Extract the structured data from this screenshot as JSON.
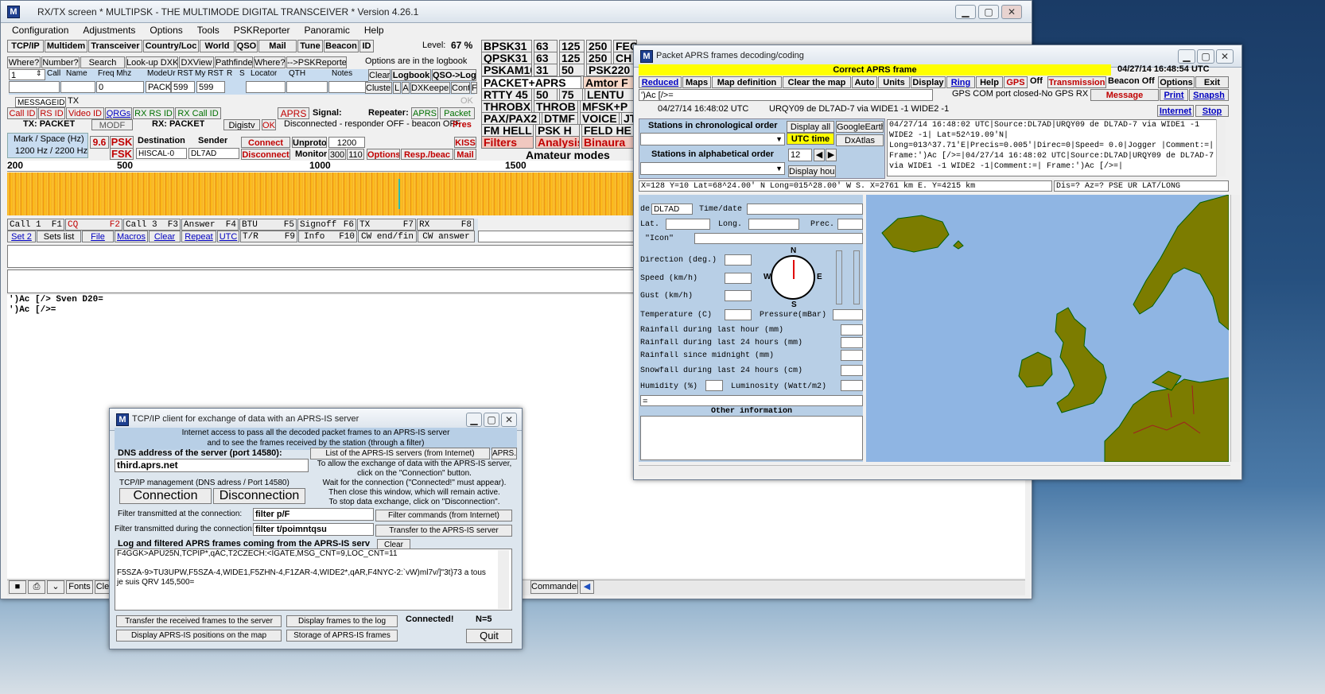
{
  "main": {
    "title": "RX/TX screen  * MULTIPSK - THE MULTIMODE DIGITAL TRANSCEIVER *   Version 4.26.1",
    "menu": [
      "Configuration",
      "Adjustments",
      "Options",
      "Tools",
      "PSKReporter",
      "Panoramic",
      "Help"
    ],
    "toolbar": [
      "TCP/IP",
      "Multidem",
      "Transceiver",
      "Country/Loc",
      "World",
      "QSO",
      "Mail",
      "Tune",
      "Beacon",
      "ID"
    ],
    "level_label": "Level:",
    "level_value": "67 %",
    "lookup": [
      "Where?",
      "Number?",
      "Search",
      "Look-up DXK",
      "DXView",
      "Pathfinder",
      "Where?",
      "-->PSKReporter"
    ],
    "logbook_note": "Options are in the logbook",
    "log_headers": [
      "Call",
      "Name",
      "Freq Mhz",
      "ModeUr",
      "RST",
      "My RST",
      "R",
      "S",
      "Locator",
      "QTH",
      "Notes"
    ],
    "log_row_num": "1",
    "log_freq": "0",
    "log_mode": "PACK",
    "log_rst": "599",
    "log_myrst": "599",
    "log_buttons": [
      "Clear",
      "Logbook",
      "QSO->Log",
      "Cluster",
      "L",
      "A",
      "DXKeeper",
      "Cont",
      "F"
    ],
    "messageid": "MESSAGEID",
    "tx_label": "TX",
    "ok": "OK",
    "id_buttons": [
      "Call ID",
      "RS ID",
      "Video ID",
      "QRGs",
      "RX RS ID",
      "RX Call ID",
      "APRS"
    ],
    "signal_label": "Signal:",
    "repeater_label": "Repeater:",
    "aprs_btn": "APRS",
    "packet_btn": "Packet",
    "tx_mode": "TX: PACKET",
    "modf": "MODF",
    "rx_mode": "RX: PACKET",
    "digistv": "Digistv",
    "ok2": "OK",
    "disconnected_status": "Disconnected - responder OFF - beacon OFF",
    "pres": "Pres",
    "mark_space_label": "Mark / Space (Hz)",
    "mark_space_value": "1200 Hz / 2200 Hz",
    "baud": "9.6",
    "psk": "PSK",
    "fsk": "FSK",
    "dest_label": "Destination",
    "sender_label": "Sender",
    "dest_value": "HISCAL-0",
    "sender_value": "DL7AD",
    "connect": "Connect",
    "disconnect": "Disconnect",
    "unproto": "Unproto",
    "monitor": "Monitor",
    "speed_1200": "1200",
    "speed_300": "300",
    "speed_110": "110",
    "options_btn": "Options",
    "resp_btn": "Resp./beac",
    "kiss": "KISS",
    "mail_btn": "Mail",
    "modes": [
      [
        "BPSK31",
        "63",
        "125",
        "250",
        "FEC"
      ],
      [
        "QPSK31",
        "63",
        "125",
        "250",
        "CH"
      ],
      [
        "PSKAM10",
        "31",
        "50",
        "PSK220"
      ]
    ],
    "modes_b": [
      "PACKET+APRS",
      "Amtor F",
      "RTTY 45",
      "50",
      "75",
      "LENTU",
      "THROBX",
      "THROB",
      "MFSK+P",
      "PAX/PAX2",
      "DTMF",
      "VOICE",
      "JT",
      "FM HELL",
      "PSK H",
      "FELD HE"
    ],
    "filters": "Filters",
    "analysis": "Analysis",
    "binaural": "Binaura",
    "amateur_modes": "Amateur modes",
    "freq_ticks": [
      "200",
      "500",
      "1000",
      "1500"
    ],
    "macros_row1": [
      "Call 1",
      "F1",
      "CQ",
      "F2",
      "Call 3",
      "F3",
      "Answer",
      "F4",
      "BTU",
      "F5",
      "Signoff",
      "F6",
      "TX",
      "F7",
      "RX",
      "F8"
    ],
    "macros_row2": [
      "Set 2",
      "Sets list",
      "File",
      "Macros",
      "Clear",
      "Repeat",
      "UTC",
      "T/R",
      "F9",
      "Info",
      "F10",
      "CW end/fin",
      "CW answer"
    ],
    "rx_lines": [
      "')Ac  [/> Sven D20=",
      "')Ac  [/>="
    ],
    "bottom_buttons": [
      "Fonts",
      "Cle",
      "Commander"
    ]
  },
  "aprs": {
    "title": "Packet APRS frames decoding/coding",
    "correct_frame": "Correct APRS frame",
    "datetime": "04/27/14 16:48:54 UTC",
    "buttons": [
      "Reduced",
      "Maps",
      "Map definition",
      "Clear the map",
      "Auto",
      "Units",
      "Display",
      "Ring",
      "Help",
      "GPS",
      "Off",
      "Transmission",
      "Beacon Off",
      "Options",
      "Exit"
    ],
    "frame_text": "')Ac [/>=",
    "gps_status": "GPS COM port closed-No GPS RX",
    "message": "Message",
    "print": "Print",
    "snapshot": "Snapsh",
    "frame_time": "04/27/14 16:48:02 UTC",
    "frame_path": "URQY09 de DL7AD-7 via  WIDE1 -1 WIDE2 -1",
    "internet": "Internet",
    "stop": "Stop",
    "stations_chrono": "Stations in chronological order",
    "display_all": "Display all",
    "google_earth": "GoogleEarth",
    "utc_time": "UTC time",
    "dxatlas": "DxAtlas",
    "stations_alpha": "Stations in alphabetical order",
    "hours": "12",
    "display_hour": "Display hour",
    "log_text": "04/27/14 16:48:02 UTC|Source:DL7AD|URQY09 de DL7AD-7 via WIDE1 -1 WIDE2 -1| Lat=52^19.09'N| Long=013^37.71'E|Precis=0.005'|Direc=0|Speed=  0.0|Jogger |Comment:=| Frame:')Ac [/>=|04/27/14 16:48:02 UTC|Source:DL7AD|URQY09 de DL7AD-7 via WIDE1 -1 WIDE2 -1|Comment:=| Frame:')Ac  [/>=|",
    "coords": "X=128 Y=10   Lat=68^24.00' N Long=015^28.00' W S. X=2761 km    E. Y=4215 km",
    "dis": "Dis=? Az=? PSE UR LAT/LONG",
    "de_label": "de",
    "de_value": "DL7AD",
    "timedate_label": "Time/date",
    "lat_label": "Lat.",
    "long_label": "Long.",
    "prec_label": "Prec.",
    "icon_label": "\"Icon\"",
    "fields": [
      "Direction (deg.)",
      "Speed (km/h)",
      "Gust (km/h)",
      "Temperature (C)",
      "Pressure(mBar)"
    ],
    "compass": [
      "N",
      "E",
      "S",
      "W"
    ],
    "rain": [
      "Rainfall during last hour (mm)",
      "Rainfall during last 24 hours (mm)",
      "Rainfall since midnight (mm)",
      "Snowfall during last 24 hours (cm)"
    ],
    "humidity": "Humidity (%)",
    "luminosity": "Luminosity (Watt/m2)",
    "eq": "=",
    "other_info": "Other information",
    "colors": {
      "sea": "#8fb5e3",
      "land": "#7c7c00",
      "yellow": "#ffff00"
    }
  },
  "tcp": {
    "title": "TCP/IP client for exchange of data with an APRS-IS server",
    "intro1": "Internet access to pass all the decoded packet frames to an APRS-IS server",
    "intro2": "and to see the frames received by the station (through a filter)",
    "dns_label": "DNS address of the server (port 14580):",
    "dns_value": "third.aprs.net",
    "list_btn": "List of the APRS-IS servers (from Internet)",
    "aprsfi": "APRS.fi",
    "mgmt": "TCP/IP management (DNS adress / Port 14580)",
    "connection": "Connection",
    "disconnection": "Disconnection",
    "help": [
      "To allow the exchange of data with the APRS-IS server,",
      "click on the \"Connection\" button.",
      "Wait for the connection (\"Connected!\" must appear).",
      "Then close this window, which will remain active.",
      "To stop data exchange, click on \"Disconnection\"."
    ],
    "filter_conn_label": "Filter transmitted at the connection:",
    "filter_conn_value": "filter p/F",
    "filter_during_label": "Filter transmitted during the connection:",
    "filter_during_value": "filter t/poimntqsu",
    "filter_cmds": "Filter commands (from Internet)",
    "transfer_server": "Transfer to the APRS-IS server",
    "log_label": "Log and filtered APRS frames coming from the APRS-IS serv",
    "clear": "Clear",
    "log_lines": [
      "F4GGK>APU25N,TCPIP*,qAC,T2CZECH:<IGATE,MSG_CNT=9,LOC_CNT=11",
      "",
      "F5SZA-9>TU3UPW,F5SZA-4,WIDE1,F5ZHN-4,F1ZAR-4,WIDE2*,qAR,F4NYC-2:`vW)ml7v/]\"3t}73 a tous",
      "je suis QRV 145,500="
    ],
    "transfer_received": "Transfer the received frames to the server",
    "display_frames": "Display frames to the log",
    "connected": "Connected!",
    "n_label": "N=5",
    "display_positions": "Display APRS-IS positions on the map",
    "storage": "Storage of APRS-IS frames",
    "quit": "Quit"
  }
}
